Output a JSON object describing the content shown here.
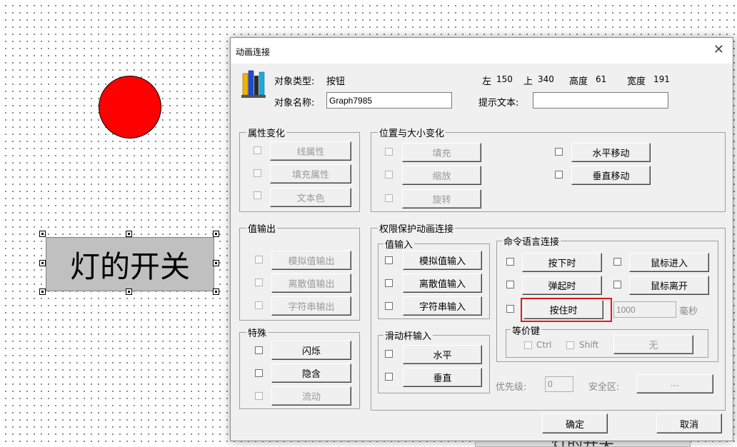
{
  "canvas": {
    "button_text": "灯的开关",
    "lamp_color": "#ff0000",
    "background_fragment": "灯的开关"
  },
  "dialog": {
    "title": "动画连接",
    "close_glyph": "✕",
    "object_type_label": "对象类型:",
    "object_type_value": "按钮",
    "left_label": "左",
    "left_value": "150",
    "top_label": "上",
    "top_value": "340",
    "height_label": "高度",
    "height_value": "61",
    "width_label": "宽度",
    "width_value": "191",
    "object_name_label": "对象名称:",
    "object_name_value": "Graph7985",
    "tooltip_label": "提示文本:",
    "tooltip_value": "",
    "attribute_group": {
      "title": "属性变化",
      "buttons": [
        "线属性",
        "填充属性",
        "文本色"
      ]
    },
    "position_group": {
      "title": "位置与大小变化",
      "left_buttons": [
        "填充",
        "缩放",
        "旋转"
      ],
      "right_buttons": [
        "水平移动",
        "垂直移动"
      ]
    },
    "value_output_group": {
      "title": "值输出",
      "buttons": [
        "模拟值输出",
        "离散值输出",
        "字符串输出"
      ]
    },
    "special_group": {
      "title": "特殊",
      "buttons": [
        "闪烁",
        "隐含",
        "流动"
      ]
    },
    "protection_group": {
      "title": "权限保护动画连接",
      "value_input_title": "值输入",
      "value_input_buttons": [
        "模拟值输入",
        "离散值输入",
        "字符串输入"
      ],
      "slider_title": "滑动杆输入",
      "slider_buttons": [
        "水平",
        "垂直"
      ],
      "command_title": "命令语言连接",
      "command_buttons": [
        "按下时",
        "弹起时",
        "按住时"
      ],
      "mouse_buttons": [
        "鼠标进入",
        "鼠标离开"
      ],
      "hold_ms_value": "1000",
      "ms_label": "毫秒",
      "hotkey_title": "等价键",
      "ctrl_label": "Ctrl",
      "shift_label": "Shift",
      "key_button": "无",
      "priority_label": "优先级:",
      "priority_value": "0",
      "security_label": "安全区:",
      "security_button": "..."
    },
    "ok_button": "确定",
    "cancel_button": "取消"
  }
}
